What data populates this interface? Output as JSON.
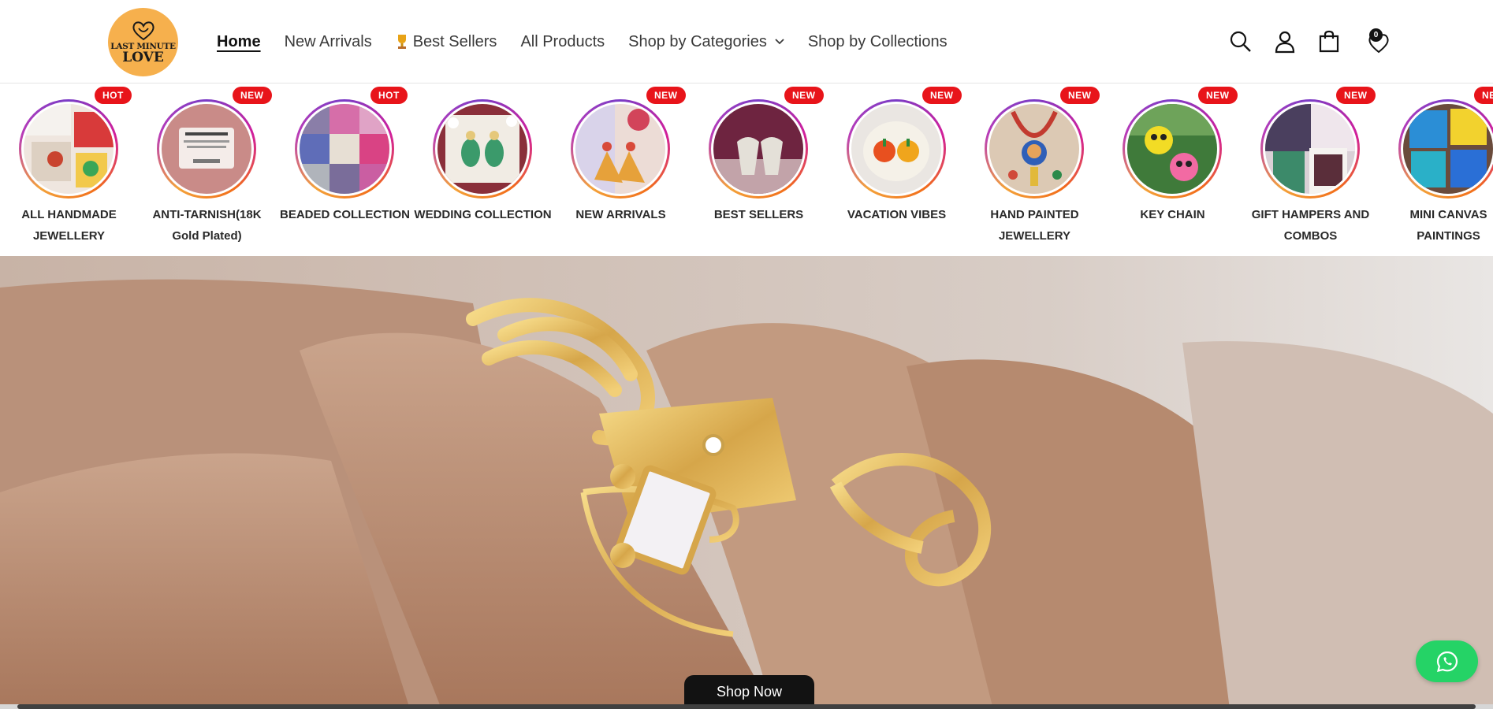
{
  "brand": {
    "logo_line1": "LAST MINUTE",
    "logo_line2": "LOVE"
  },
  "nav": {
    "home": "Home",
    "new_arrivals": "New Arrivals",
    "best_sellers": "Best Sellers",
    "all_products": "All Products",
    "shop_by_categories": "Shop by Categories",
    "shop_by_collections": "Shop by Collections"
  },
  "header_icons": {
    "search": "search-icon",
    "account": "account-icon",
    "cart": "cart-icon",
    "wishlist": "heart-icon",
    "wishlist_count": "0"
  },
  "categories": [
    {
      "label": "ALL HANDMADE JEWELLERY",
      "badge": "HOT"
    },
    {
      "label": "ANTI-TARNISH(18K Gold Plated)",
      "badge": "NEW"
    },
    {
      "label": "BEADED COLLECTION",
      "badge": "HOT"
    },
    {
      "label": "WEDDING COLLECTION",
      "badge": ""
    },
    {
      "label": "NEW ARRIVALS",
      "badge": "NEW"
    },
    {
      "label": "BEST SELLERS",
      "badge": "NEW"
    },
    {
      "label": "VACATION VIBES",
      "badge": "NEW"
    },
    {
      "label": "HAND PAINTED JEWELLERY",
      "badge": "NEW"
    },
    {
      "label": "KEY CHAIN",
      "badge": "NEW"
    },
    {
      "label": "GIFT HAMPERS AND COMBOS",
      "badge": "NEW"
    },
    {
      "label": "MINI CANVAS PAINTINGS",
      "badge": "NEW"
    }
  ],
  "hero": {
    "cta": "Shop Now"
  },
  "colors": {
    "badge_red": "#e8141a",
    "logo_orange": "#f6b04d",
    "whatsapp_green": "#25d366"
  }
}
